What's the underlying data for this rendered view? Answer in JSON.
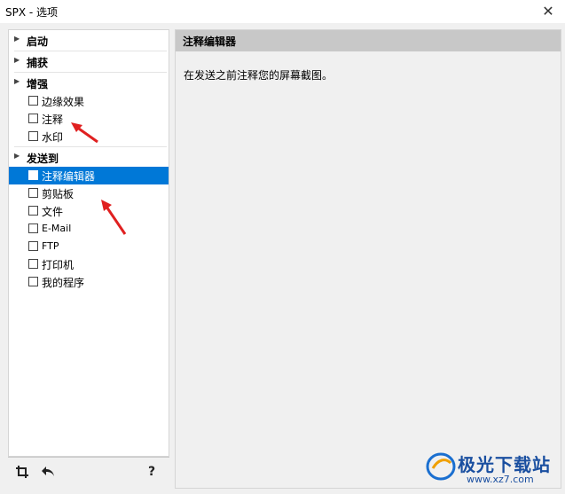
{
  "window": {
    "title": "SPX - 选项",
    "close_icon": "✕"
  },
  "sidebar": {
    "groups": [
      {
        "label": "启动",
        "items": []
      },
      {
        "label": "捕获",
        "items": []
      },
      {
        "label": "增强",
        "items": [
          {
            "label": "边缘效果"
          },
          {
            "label": "注释"
          },
          {
            "label": "水印"
          }
        ]
      },
      {
        "label": "发送到",
        "items": [
          {
            "label": "注释编辑器",
            "selected": true
          },
          {
            "label": "剪贴板"
          },
          {
            "label": "文件"
          },
          {
            "label": "E-Mail"
          },
          {
            "label": "FTP"
          },
          {
            "label": "打印机"
          },
          {
            "label": "我的程序"
          }
        ]
      }
    ],
    "footer": {
      "crop_icon": "crop-icon",
      "undo_icon": "undo-icon",
      "help_label": "?"
    }
  },
  "content": {
    "header": "注释编辑器",
    "description": "在发送之前注释您的屏幕截图。"
  },
  "watermark": {
    "text": "极光下载站",
    "url": "www.xz7.com"
  },
  "colors": {
    "selection": "#0078d7",
    "arrow": "#e02020",
    "header_bg": "#c8c8c8"
  }
}
